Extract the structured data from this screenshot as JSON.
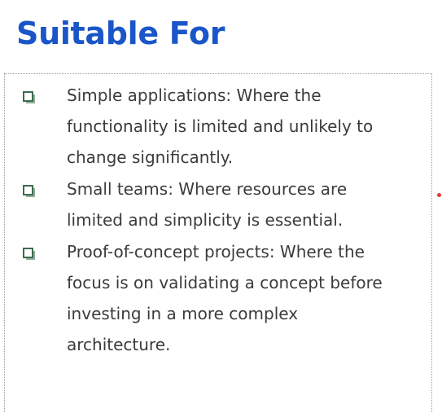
{
  "title": "Suitable For",
  "bullets": [
    {
      "lines": [
        "Simple applications: Where the",
        "functionality is limited and unlikely to",
        "change significantly."
      ]
    },
    {
      "lines": [
        "Small teams: Where resources are",
        "limited and simplicity is essential."
      ]
    },
    {
      "lines": [
        "Proof-of-concept projects: Where the",
        "focus is on validating a concept before",
        "investing in a more complex",
        "architecture."
      ]
    }
  ],
  "colors": {
    "title": "#1a56c8",
    "text": "#3b3b3b",
    "bullet": "#3a6d4f",
    "marker": "#e23b3b"
  },
  "icons": {
    "bullet": "checkbox-square-icon"
  }
}
